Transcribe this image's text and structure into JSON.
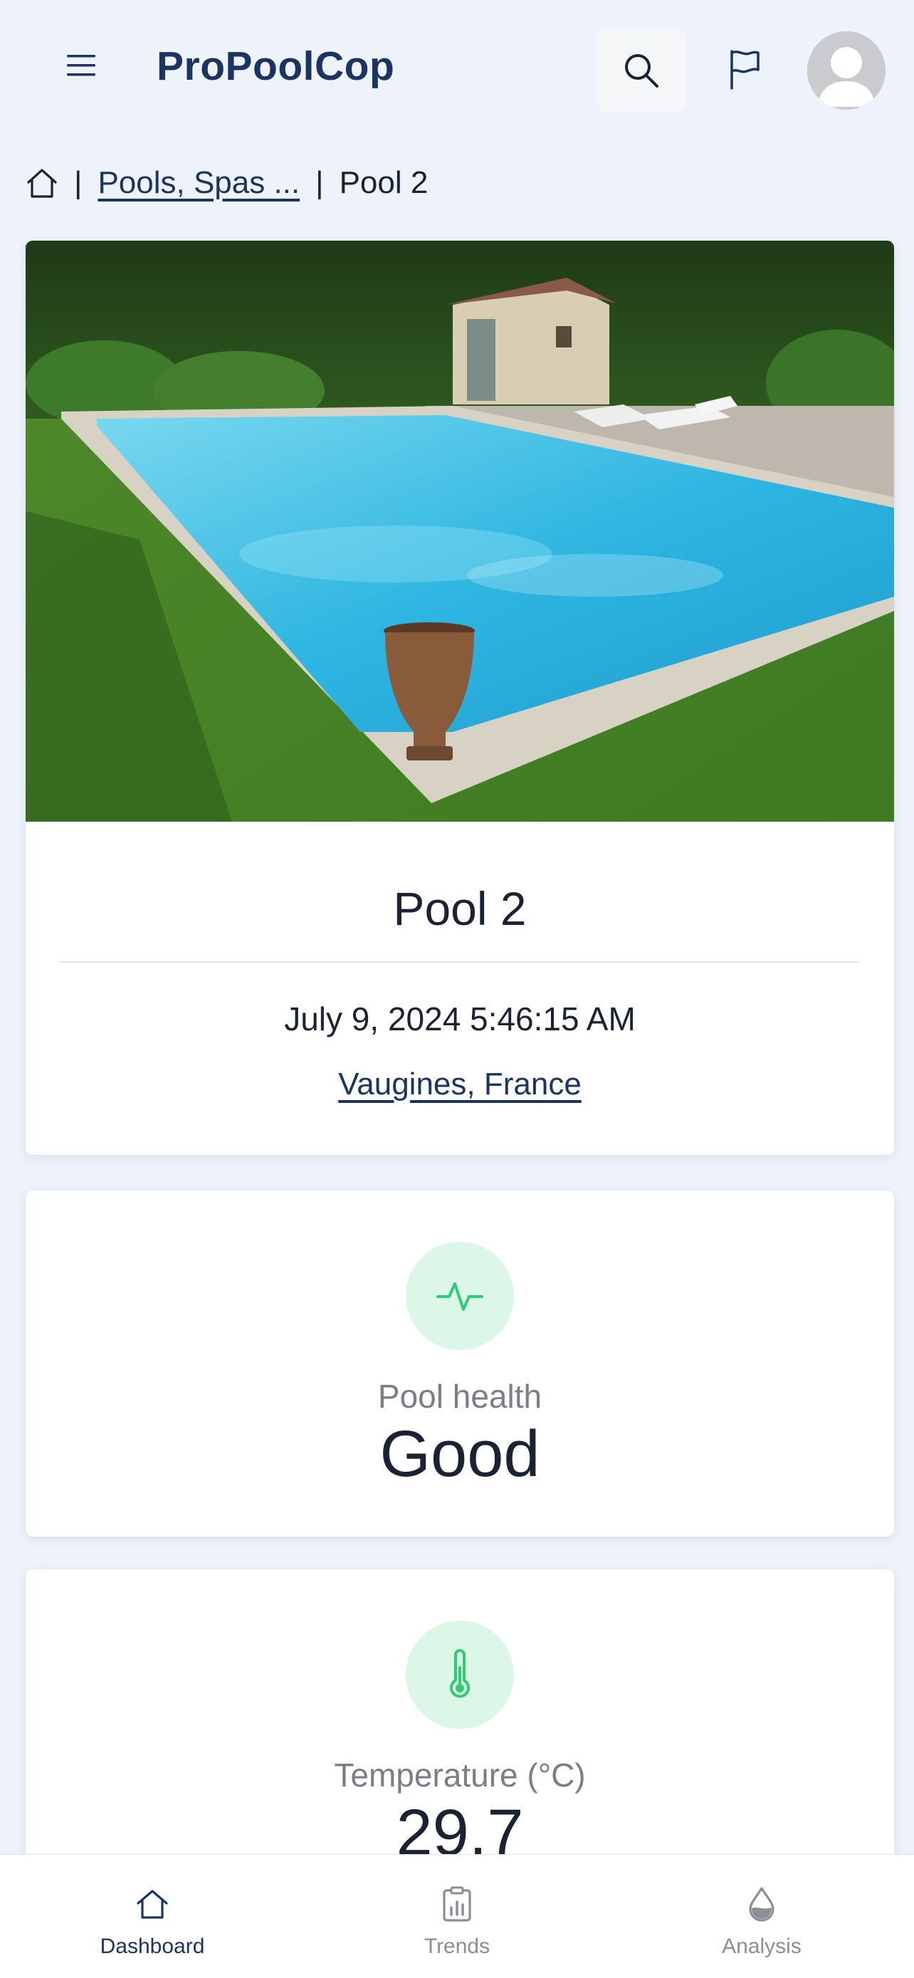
{
  "header": {
    "brand": "ProPoolCop",
    "menu_icon": "hamburger-menu-icon",
    "search_icon": "search-icon",
    "flag_icon": "flag-icon",
    "avatar_icon": "user-avatar-icon"
  },
  "breadcrumb": {
    "home_icon": "home-icon",
    "separator": "|",
    "items": [
      {
        "label": "Pools, Spas ..."
      },
      {
        "label": "Pool 2"
      }
    ]
  },
  "pool": {
    "photo": "outdoor swimming pool photo",
    "name": "Pool 2",
    "timestamp": "July 9, 2024 5:46:15 AM",
    "location": "Vaugines, France"
  },
  "metrics": [
    {
      "icon": "activity-pulse-icon",
      "label": "Pool health",
      "value": "Good",
      "icon_color": "#2ecc71"
    },
    {
      "icon": "thermometer-icon",
      "label": "Temperature (°C)",
      "value": "29.7",
      "icon_color": "#2ecc71"
    }
  ],
  "bottom_nav": {
    "items": [
      {
        "label": "Dashboard",
        "icon": "home-icon",
        "active": true
      },
      {
        "label": "Trends",
        "icon": "clipboard-chart-icon",
        "active": false
      },
      {
        "label": "Analysis",
        "icon": "water-drop-icon",
        "active": false
      }
    ]
  },
  "colors": {
    "brand": "#1b3461",
    "background": "#eef2fa",
    "accent_soft": "#dcf7e8",
    "accent": "#2ecc71"
  }
}
